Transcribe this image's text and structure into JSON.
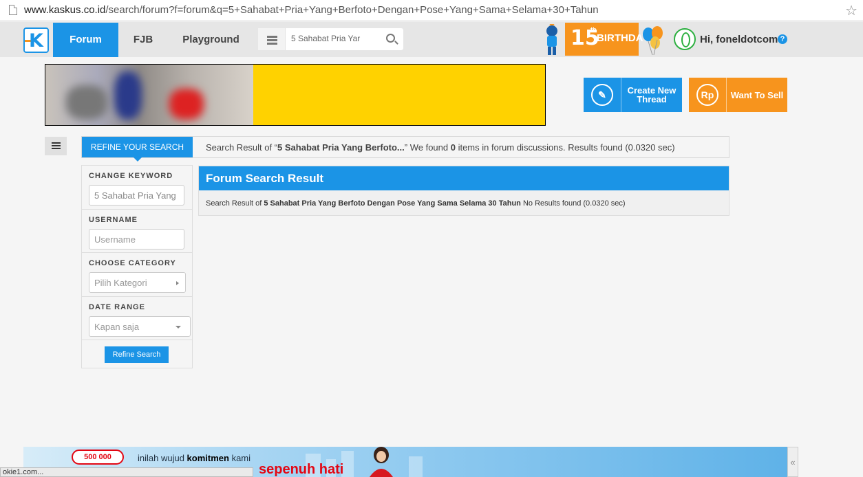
{
  "browser": {
    "url_host": "www.kaskus.co.id",
    "url_rest": "/search/forum?f=forum&q=5+Sahabat+Pria+Yang+Berfoto+Dengan+Pose+Yang+Sama+Selama+30+Tahun",
    "status_text": "okie1.com..."
  },
  "nav": {
    "logo_letter": "K",
    "tabs": [
      {
        "label": "Forum",
        "active": true
      },
      {
        "label": "FJB",
        "active": false
      },
      {
        "label": "Playground",
        "active": false
      }
    ],
    "search_value": "5 Sahabat Pria Yar",
    "birthday_number": "15",
    "birthday_sup": "th",
    "birthday_text": "BIRTHDAY",
    "greeting": "Hi, foneldotcom",
    "help_symbol": "?",
    "accent": "#1b94e6"
  },
  "cta": {
    "create_label": "Create New Thread",
    "create_color": "#1b94e6",
    "sell_icon": "Rp",
    "sell_label": "Want To Sell",
    "sell_color": "#f7941d"
  },
  "refine": {
    "tab_label": "REFINE YOUR SEARCH",
    "summary_prefix": "Search Result of “",
    "summary_query": "5 Sahabat Pria Yang Berfoto...",
    "summary_mid": "” We found ",
    "summary_count": "0",
    "summary_suffix": " items in forum discussions. Results found (0.0320 sec)"
  },
  "sidebar": {
    "keyword_title": "CHANGE KEYWORD",
    "keyword_value": "5 Sahabat Pria Yang",
    "username_title": "USERNAME",
    "username_placeholder": "Username",
    "category_title": "CHOOSE CATEGORY",
    "category_value": "Pilih Kategori",
    "date_title": "DATE RANGE",
    "date_value": "Kapan saja",
    "button_label": "Refine Search"
  },
  "results": {
    "title": "Forum Search Result",
    "prefix": "Search Result of ",
    "query": "5 Sahabat Pria Yang Berfoto Dengan Pose Yang Sama Selama 30 Tahun",
    "suffix": " No Results found (0.0320 sec)"
  },
  "ad": {
    "badge": "500 000",
    "line_pre": "inilah wujud ",
    "line_bold": "komitmen",
    "line_post": " kami",
    "tagline": "sepenuh hati",
    "side_arrow": "«"
  }
}
